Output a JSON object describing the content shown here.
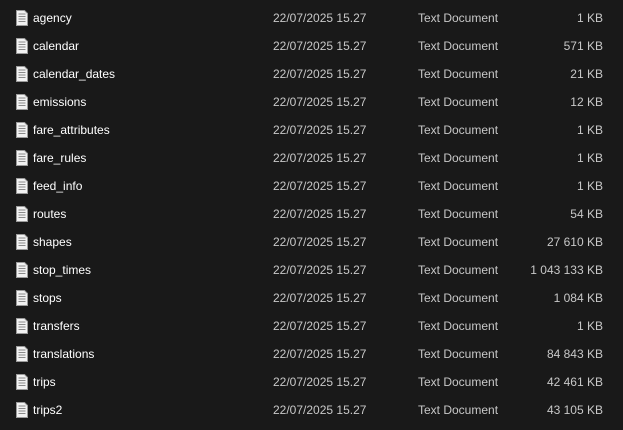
{
  "files": [
    {
      "name": "agency",
      "modified": "22/07/2025 15.27",
      "type": "Text Document",
      "size": "1 KB",
      "icon": "text-document-icon"
    },
    {
      "name": "calendar",
      "modified": "22/07/2025 15.27",
      "type": "Text Document",
      "size": "571 KB",
      "icon": "text-document-icon"
    },
    {
      "name": "calendar_dates",
      "modified": "22/07/2025 15.27",
      "type": "Text Document",
      "size": "21 KB",
      "icon": "text-document-icon"
    },
    {
      "name": "emissions",
      "modified": "22/07/2025 15.27",
      "type": "Text Document",
      "size": "12 KB",
      "icon": "text-document-icon"
    },
    {
      "name": "fare_attributes",
      "modified": "22/07/2025 15.27",
      "type": "Text Document",
      "size": "1 KB",
      "icon": "text-document-icon"
    },
    {
      "name": "fare_rules",
      "modified": "22/07/2025 15.27",
      "type": "Text Document",
      "size": "1 KB",
      "icon": "text-document-icon"
    },
    {
      "name": "feed_info",
      "modified": "22/07/2025 15.27",
      "type": "Text Document",
      "size": "1 KB",
      "icon": "text-document-icon"
    },
    {
      "name": "routes",
      "modified": "22/07/2025 15.27",
      "type": "Text Document",
      "size": "54 KB",
      "icon": "text-document-icon"
    },
    {
      "name": "shapes",
      "modified": "22/07/2025 15.27",
      "type": "Text Document",
      "size": "27 610 KB",
      "icon": "text-document-icon"
    },
    {
      "name": "stop_times",
      "modified": "22/07/2025 15.27",
      "type": "Text Document",
      "size": "1 043 133 KB",
      "icon": "text-document-icon"
    },
    {
      "name": "stops",
      "modified": "22/07/2025 15.27",
      "type": "Text Document",
      "size": "1 084 KB",
      "icon": "text-document-icon"
    },
    {
      "name": "transfers",
      "modified": "22/07/2025 15.27",
      "type": "Text Document",
      "size": "1 KB",
      "icon": "text-document-icon"
    },
    {
      "name": "translations",
      "modified": "22/07/2025 15.27",
      "type": "Text Document",
      "size": "84 843 KB",
      "icon": "text-document-icon"
    },
    {
      "name": "trips",
      "modified": "22/07/2025 15.27",
      "type": "Text Document",
      "size": "42 461 KB",
      "icon": "text-document-icon"
    },
    {
      "name": "trips2",
      "modified": "22/07/2025 15.27",
      "type": "Text Document",
      "size": "43 105 KB",
      "icon": "text-document-icon"
    }
  ],
  "colors": {
    "background": "#191919",
    "name_text": "#ffffff",
    "detail_text": "#c8c8c8",
    "icon_fill": "#f2f2f2",
    "icon_lines": "#8a8a8a"
  }
}
